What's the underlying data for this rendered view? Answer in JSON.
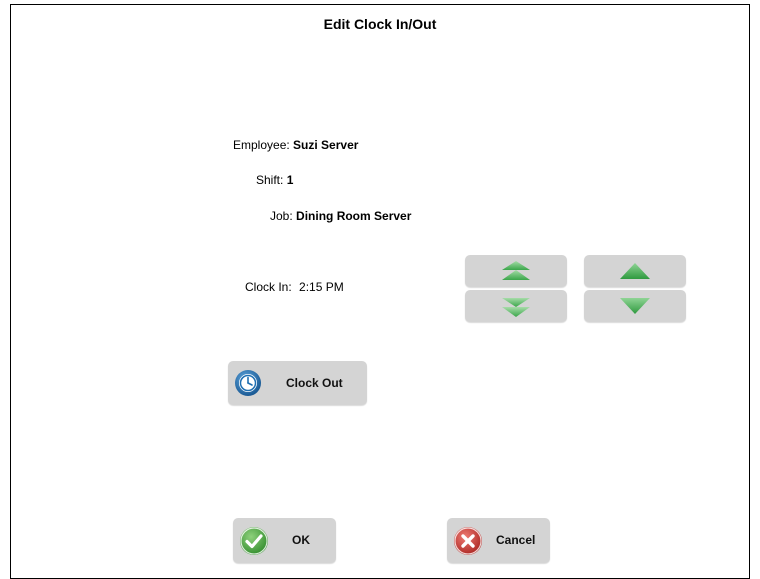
{
  "dialog": {
    "title": "Edit Clock In/Out"
  },
  "details": {
    "employee_label": "Employee:",
    "employee_value": "Suzi Server",
    "shift_label": "Shift:",
    "shift_value": "1",
    "job_label": "Job:",
    "job_value": "Dining Room Server",
    "clock_in_label": "Clock In:",
    "clock_in_value": "2:15 PM"
  },
  "adjusters": {
    "page_up_icon": "double-chevron-up-icon",
    "page_down_icon": "double-chevron-down-icon",
    "up_icon": "triangle-up-icon",
    "down_icon": "triangle-down-icon"
  },
  "actions": {
    "clock_out_label": "Clock Out",
    "ok_label": "OK",
    "cancel_label": "Cancel"
  },
  "colors": {
    "button_bg": "#d4d4d4",
    "arrow_green": "#3aa64a",
    "arrow_green_light": "#7fc98a",
    "clock_blue": "#1f6fb2",
    "ok_green": "#4aa63c",
    "cancel_red": "#c8322d"
  }
}
